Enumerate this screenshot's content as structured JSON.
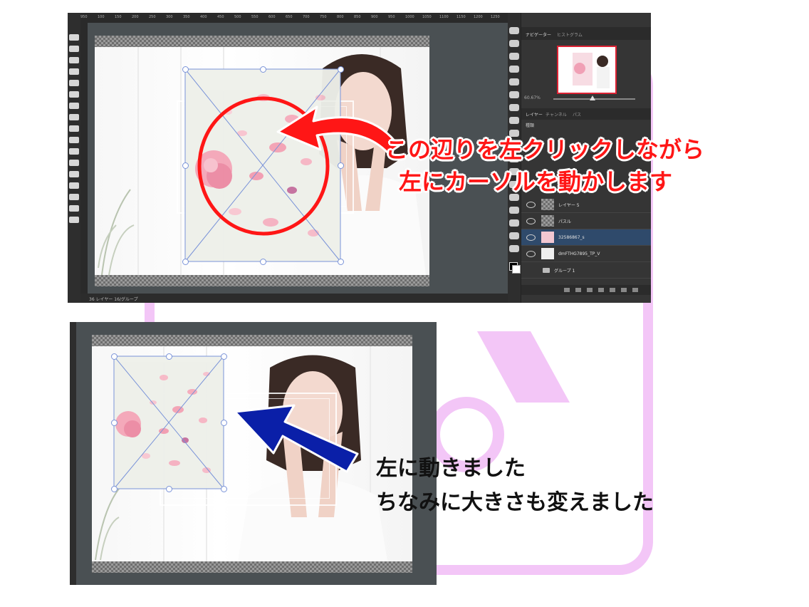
{
  "top_screenshot": {
    "ruler_labels": [
      "950",
      "100",
      "150",
      "200",
      "250",
      "300",
      "350",
      "400",
      "450",
      "500",
      "550",
      "600",
      "650",
      "700",
      "750",
      "800",
      "850",
      "900",
      "950",
      "1000",
      "1050",
      "1100",
      "1150",
      "1200",
      "1250"
    ],
    "panel_tabs": [
      "ナビゲーター",
      "ヒストグラム"
    ],
    "zoom_text": "60.67%",
    "layer_tabs": [
      "レイヤー",
      "チャンネル",
      "パス"
    ],
    "layer_kind": "種類",
    "layers": [
      {
        "name": "レイヤー 5",
        "selected": false
      },
      {
        "name": "パスル",
        "selected": false
      },
      {
        "name": "32586867_s",
        "selected": true
      },
      {
        "name": "dmFTHG7895_TP_V",
        "selected": false
      },
      {
        "name": "グループ 1",
        "selected": false
      }
    ],
    "bottom_status": "36 レイヤー 16/グループ"
  },
  "captions": {
    "red_line1": "この辺りを左クリックしながら",
    "red_line2": "左にカーソルを動かします",
    "black_line1": "左に動きました",
    "black_line2": "ちなみに大きさも変えました"
  },
  "colors": {
    "ps_dark": "#3a3a3a",
    "ps_canvas": "#4a5053",
    "transform_line": "#7a93d8",
    "red_annotation": "#ff1616",
    "blue_arrow": "#0a1fa8",
    "selected_layer": "#2f4a6b",
    "watermark_pink": "#f3c6f7"
  }
}
